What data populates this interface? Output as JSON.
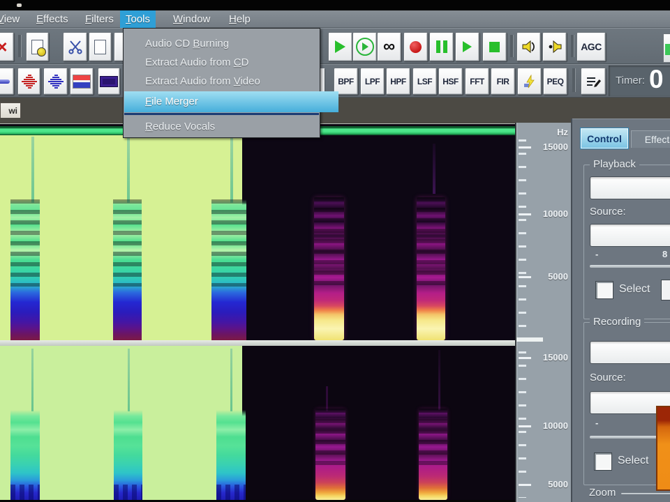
{
  "colors": {
    "menu_highlight_blue": "#2f9fd6",
    "dropdown_selection_blue": "#46aeda",
    "green_position_bar": "#4ce68b",
    "record_red": "#c81818",
    "transport_green": "#28bf2c",
    "spectrogram_lime": "#d6f194",
    "spectrogram_hot_yellow": "#f6e88a",
    "meter_orange": "#ef8c16",
    "active_tab_blue": "#a6d9ee"
  },
  "icons": {
    "delete_glyph": "×",
    "infinity_glyph": "∞"
  },
  "menu_bar": {
    "items": [
      {
        "label": "View",
        "underline": 0
      },
      {
        "label": "Effects",
        "underline": 0
      },
      {
        "label": "Filters",
        "underline": 0
      },
      {
        "label": "Tools",
        "underline": 0,
        "active": true
      },
      {
        "label": "Window",
        "underline": 0
      },
      {
        "label": "Help",
        "underline": 0
      }
    ]
  },
  "tools_menu": {
    "items": [
      {
        "label": "Audio CD Burning",
        "underline": 9
      },
      {
        "label": "Extract Audio from CD",
        "underline": 19
      },
      {
        "label": "Extract Audio from Video",
        "underline": 19
      },
      {
        "label": "File Merger",
        "underline": 0,
        "highlighted": true
      },
      {
        "label": "Reduce Vocals",
        "underline": 0
      }
    ]
  },
  "toolbar": {
    "agc_label": "AGC",
    "filters": [
      "BPF",
      "LPF",
      "HPF",
      "LSF",
      "HSF",
      "FFT",
      "FIR",
      "PEQ"
    ],
    "timer_label": "Timer:",
    "timer_value": "0"
  },
  "file_tab": {
    "label": "wi"
  },
  "ruler": {
    "unit": "Hz",
    "top_labels": [
      "15000",
      "10000",
      "5000"
    ],
    "bottom_labels": [
      "15000",
      "10000",
      "5000"
    ]
  },
  "side_panel": {
    "tabs": [
      {
        "label": "Control",
        "active": true
      },
      {
        "label": "Effects",
        "active": false
      }
    ],
    "playback": {
      "title": "Playback",
      "source_label": "Source:",
      "range_min": "-",
      "range_max": "8",
      "select_label": "Select"
    },
    "recording": {
      "title": "Recording",
      "source_label": "Source:",
      "range_min": "-",
      "select_label": "Select"
    },
    "zoom_title": "Zoom"
  }
}
